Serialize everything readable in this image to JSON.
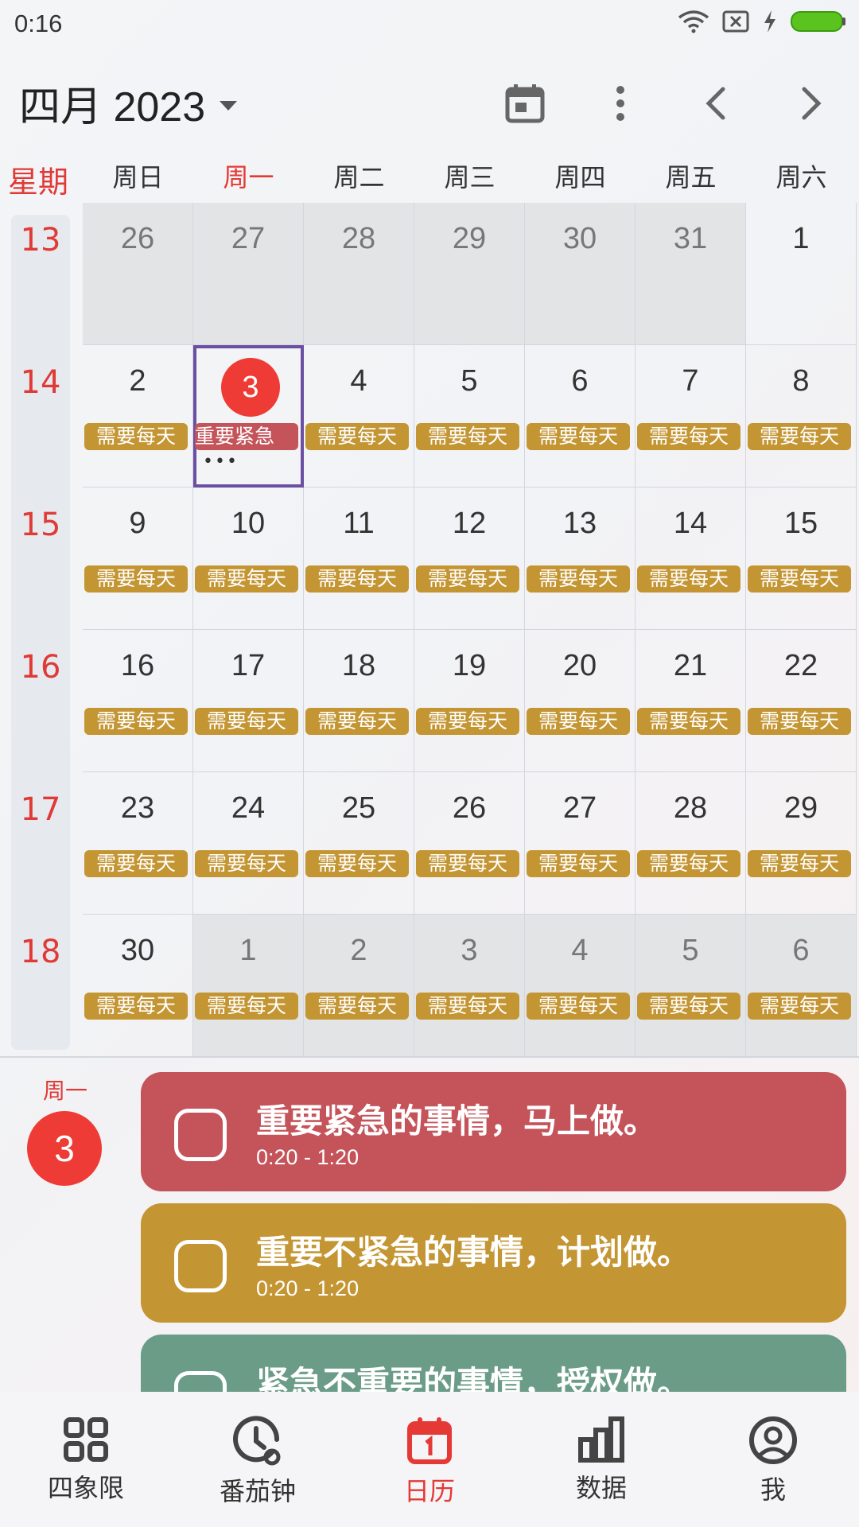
{
  "status_bar": {
    "time": "0:16"
  },
  "header": {
    "month_title": "四月 2023"
  },
  "weekdays": {
    "label": "星期",
    "days": [
      "周日",
      "周一",
      "周二",
      "周三",
      "周四",
      "周五",
      "周六"
    ]
  },
  "calendar": {
    "weeks": [
      {
        "num": "13",
        "days": [
          "26",
          "27",
          "28",
          "29",
          "30",
          "31",
          "1"
        ]
      },
      {
        "num": "14",
        "days": [
          "2",
          "3",
          "4",
          "5",
          "6",
          "7",
          "8"
        ]
      },
      {
        "num": "15",
        "days": [
          "9",
          "10",
          "11",
          "12",
          "13",
          "14",
          "15"
        ]
      },
      {
        "num": "16",
        "days": [
          "16",
          "17",
          "18",
          "19",
          "20",
          "21",
          "22"
        ]
      },
      {
        "num": "17",
        "days": [
          "23",
          "24",
          "25",
          "26",
          "27",
          "28",
          "29"
        ]
      },
      {
        "num": "18",
        "days": [
          "30",
          "1",
          "2",
          "3",
          "4",
          "5",
          "6"
        ]
      }
    ],
    "chip_daily": "需要每天",
    "chip_urgent": "重要紧急",
    "more": "•••"
  },
  "selected_day": {
    "weekday": "周一",
    "date": "3",
    "tasks": [
      {
        "title": "重要紧急的事情，马上做。",
        "time": "0:20 - 1:20",
        "color": "#c4535a"
      },
      {
        "title": "重要不紧急的事情，计划做。",
        "time": "0:20 - 1:20",
        "color": "#c49533"
      },
      {
        "title": "紧急不重要的事情，授权做。",
        "time": "",
        "color": "#6a9c87"
      }
    ]
  },
  "bottom_nav": {
    "items": [
      {
        "label": "四象限",
        "icon": "grid-icon"
      },
      {
        "label": "番茄钟",
        "icon": "clock-icon"
      },
      {
        "label": "日历",
        "icon": "calendar-icon"
      },
      {
        "label": "数据",
        "icon": "bar-chart-icon"
      },
      {
        "label": "我",
        "icon": "user-icon"
      }
    ],
    "active_index": 2
  },
  "colors": {
    "accent": "#e53935",
    "urgent": "#c4535a",
    "daily": "#c49533",
    "delegate": "#6a9c87",
    "selection": "#6a4fa3"
  }
}
